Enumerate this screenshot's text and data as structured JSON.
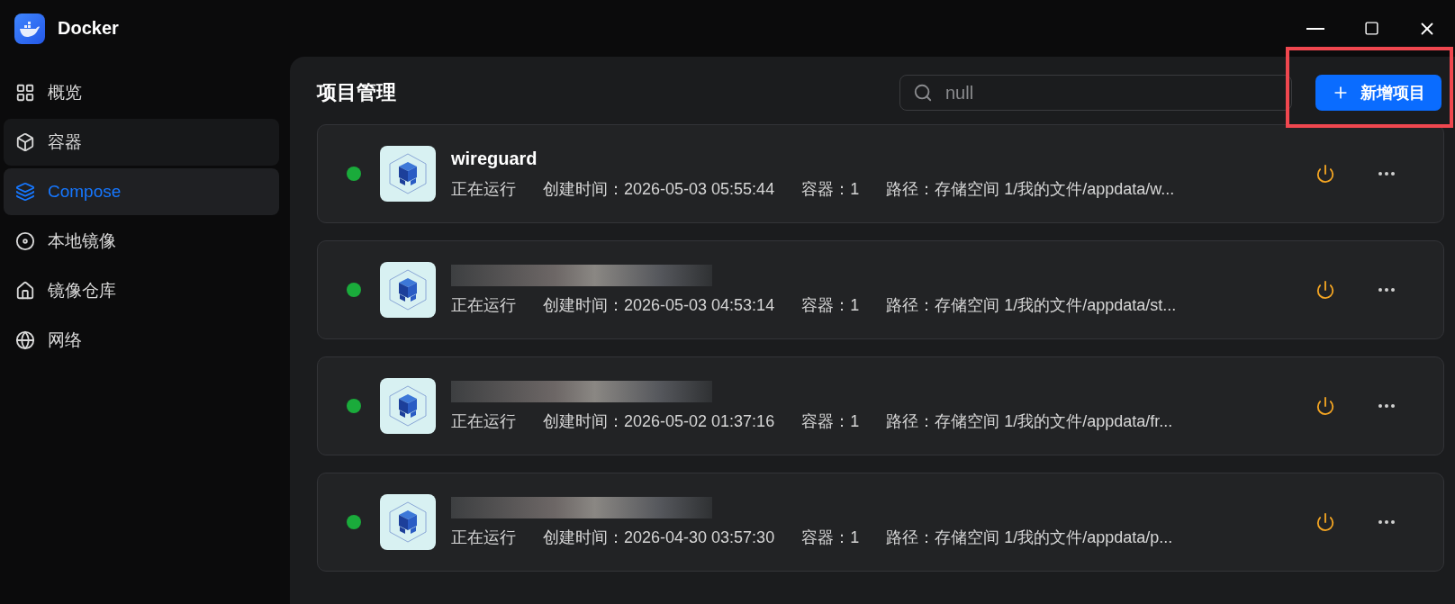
{
  "app": {
    "title": "Docker"
  },
  "sidebar": {
    "items": [
      {
        "label": "概览",
        "selected": false,
        "hovered": false
      },
      {
        "label": "容器",
        "selected": false,
        "hovered": true
      },
      {
        "label": "Compose",
        "selected": true,
        "hovered": false
      },
      {
        "label": "本地镜像",
        "selected": false,
        "hovered": false
      },
      {
        "label": "镜像仓库",
        "selected": false,
        "hovered": false
      },
      {
        "label": "网络",
        "selected": false,
        "hovered": false
      }
    ]
  },
  "page": {
    "title": "项目管理",
    "search": {
      "value": "null"
    },
    "add_button": {
      "label": "新增项目",
      "highlighted": true
    }
  },
  "projects": [
    {
      "name": "wireguard",
      "name_hidden": false,
      "running": true,
      "status": "正在运行",
      "created": "创建时间：2026-05-03 05:55:44",
      "containers": "容器：1",
      "path": "路径：存储空间 1/我的文件/appdata/w..."
    },
    {
      "name_hidden": true,
      "running": true,
      "status": "正在运行",
      "created": "创建时间：2026-05-03 04:53:14",
      "containers": "容器：1",
      "path": "路径：存储空间 1/我的文件/appdata/st..."
    },
    {
      "name_hidden": true,
      "running": true,
      "status": "正在运行",
      "created": "创建时间：2026-05-02 01:37:16",
      "containers": "容器：1",
      "path": "路径：存储空间 1/我的文件/appdata/fr..."
    },
    {
      "name_hidden": true,
      "running": true,
      "status": "正在运行",
      "created": "创建时间：2026-04-30 03:57:30",
      "containers": "容器：1",
      "path": "路径：存储空间 1/我的文件/appdata/p..."
    }
  ]
}
